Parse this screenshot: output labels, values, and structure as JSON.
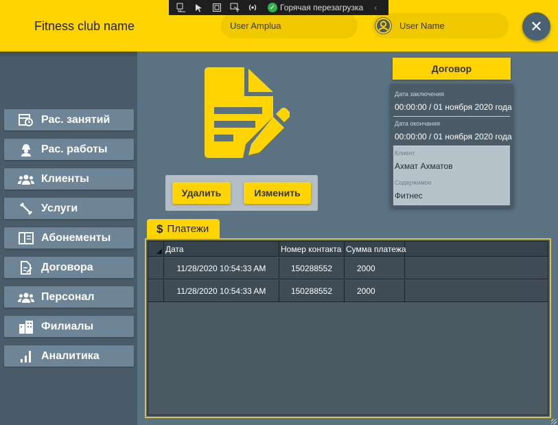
{
  "header": {
    "club_name": "Fitness club name",
    "user_amplua": "User Amplua",
    "user_name": "User Name",
    "close_glyph": "✕"
  },
  "debug_toolbar": {
    "hot_reload_label": "Горячая перезагрузка",
    "icons": [
      "live-visual-tree-icon",
      "select-element-icon",
      "display-layout-adorners-icon",
      "track-focus-icon",
      "binding-failures-icon"
    ]
  },
  "sidebar": {
    "items": [
      {
        "label": "Рас. занятий",
        "icon": "calendar-clock-icon"
      },
      {
        "label": "Рас. работы",
        "icon": "worker-icon"
      },
      {
        "label": "Клиенты",
        "icon": "clients-icon"
      },
      {
        "label": "Услуги",
        "icon": "dumbbell-icon"
      },
      {
        "label": "Абонементы",
        "icon": "membership-card-icon"
      },
      {
        "label": "Договора",
        "icon": "contract-icon"
      },
      {
        "label": "Персонал",
        "icon": "staff-icon"
      },
      {
        "label": "Филиалы",
        "icon": "buildings-icon"
      },
      {
        "label": "Аналитика",
        "icon": "analytics-icon"
      }
    ]
  },
  "actions": {
    "delete_label": "Удалить",
    "edit_label": "Изменить"
  },
  "contract": {
    "title": "Договор",
    "conclusion_date_label": "Дата заключения",
    "conclusion_date_value": "00:00:00 / 01 ноября 2020 года",
    "end_date_label": "Дата окончания",
    "end_date_value": "00:00:00 / 01 ноября 2020 года",
    "client_label": "Клиент",
    "client_value": "Ахмат Ахматов",
    "content_label": "Содержимое",
    "content_value": "Фитнес"
  },
  "payments": {
    "tab_label": "Платежи",
    "tab_icon": "dollar-icon",
    "columns": [
      "Дата",
      "Номер контакта",
      "Сумма платежа"
    ],
    "rows": [
      {
        "date": "11/28/2020 10:54:33 AM",
        "contact": "150288552",
        "amount": "2000"
      },
      {
        "date": "11/28/2020 10:54:33 AM",
        "contact": "150288552",
        "amount": "2000"
      }
    ]
  },
  "colors": {
    "accent": "#ffd400",
    "background": "#5b7283",
    "sidebar": "#4a5c69",
    "nav_button": "#6d8596"
  }
}
